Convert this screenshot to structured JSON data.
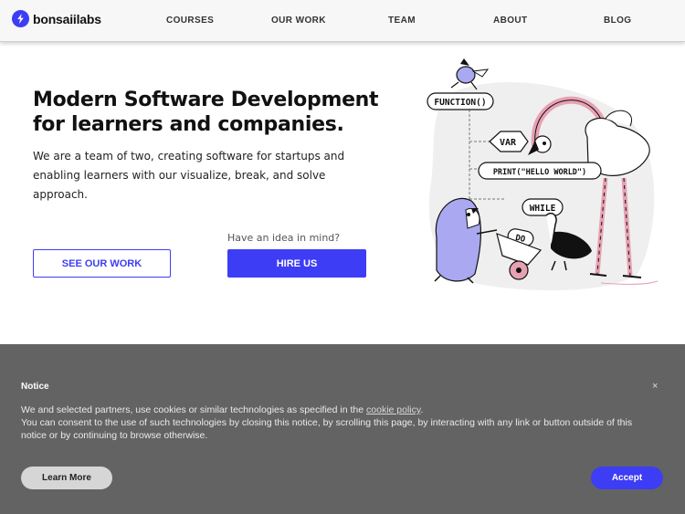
{
  "brand": {
    "name": "bonsaiilabs",
    "accent": "#3d3df5",
    "logo_icon": "bolt-icon"
  },
  "nav": {
    "items": [
      {
        "label": "COURSES"
      },
      {
        "label": "OUR WORK"
      },
      {
        "label": "TEAM"
      },
      {
        "label": "ABOUT"
      },
      {
        "label": "BLOG"
      }
    ]
  },
  "hero": {
    "title": "Modern Software Development for learners and companies.",
    "text": "We are a team of two, creating software for startups and enabling learners with our visualize, break, and solve approach.",
    "hint": "Have an idea in mind?",
    "btn_work": "SEE OUR WORK",
    "btn_hire": "HIRE US"
  },
  "illustration": {
    "labels": {
      "function": "FUNCTION()",
      "var": "VAR",
      "print": "PRINT(\"HELLO WORLD\")",
      "while": "WHILE",
      "do": "DO"
    }
  },
  "cookie": {
    "title": "Notice",
    "close": "×",
    "text_before": "We and selected partners, use cookies or similar technologies as specified in the ",
    "link": "cookie policy",
    "text_after": ".",
    "text_line2": "You can consent to the use of such technologies by closing this notice, by scrolling this page, by interacting with any link or button outside of this notice or by continuing to browse otherwise.",
    "learn_more": "Learn More",
    "accept": "Accept",
    "bg_color": "#636363"
  }
}
